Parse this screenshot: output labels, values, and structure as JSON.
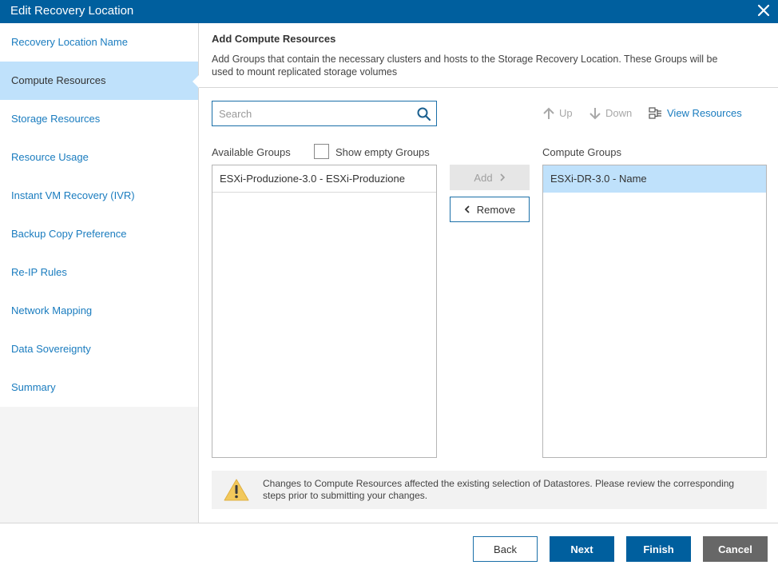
{
  "window": {
    "title": "Edit Recovery Location"
  },
  "sidebar": {
    "items": [
      {
        "label": "Recovery Location Name"
      },
      {
        "label": "Compute Resources"
      },
      {
        "label": "Storage Resources"
      },
      {
        "label": "Resource Usage"
      },
      {
        "label": "Instant VM Recovery (IVR)"
      },
      {
        "label": "Backup Copy Preference"
      },
      {
        "label": "Re-IP Rules"
      },
      {
        "label": "Network Mapping"
      },
      {
        "label": "Data Sovereignty"
      },
      {
        "label": "Summary"
      }
    ],
    "active_item": "Compute Resources"
  },
  "main": {
    "title": "Add Compute Resources",
    "description": "Add Groups that contain the necessary clusters and hosts to the Storage Recovery Location. These Groups will be used to mount replicated storage volumes",
    "search": {
      "placeholder": "Search",
      "value": ""
    },
    "toolbar": {
      "up_label": "Up",
      "down_label": "Down",
      "view_resources_label": "View Resources"
    },
    "available_groups": {
      "label": "Available Groups",
      "show_empty_label": "Show empty Groups",
      "show_empty_checked": false,
      "items": [
        "ESXi-Produzione-3.0 - ESXi-Produzione"
      ]
    },
    "add_label": "Add",
    "remove_label": "Remove",
    "compute_groups": {
      "label": "Compute Groups",
      "items": [
        "ESXi-DR-3.0 - Name"
      ],
      "selected_index": 0
    },
    "warning": "Changes to Compute Resources affected the existing selection of Datastores. Please review the corresponding steps prior to submitting your changes."
  },
  "footer": {
    "back_label": "Back",
    "next_label": "Next",
    "finish_label": "Finish",
    "cancel_label": "Cancel"
  },
  "colors": {
    "titlebar": "#005f9e",
    "accent": "#1a7cbf",
    "selection": "#bfe1fb",
    "cancel": "#676767",
    "warning_icon": "#f2c85b"
  },
  "icons": [
    "close-icon",
    "search-icon",
    "arrow-up-icon",
    "arrow-down-icon",
    "view-resources-icon",
    "chevron-right-icon",
    "chevron-left-icon",
    "warning-icon"
  ]
}
